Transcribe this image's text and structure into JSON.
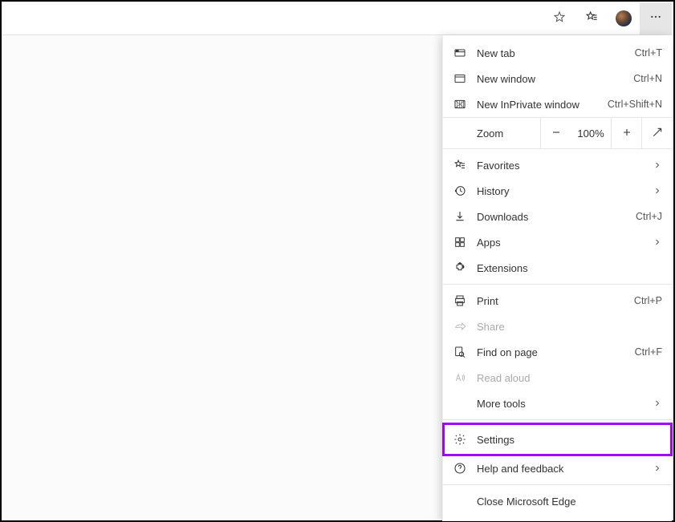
{
  "topbar": {
    "star_outline": "favorite",
    "favorites_star": "favorites",
    "more": "more"
  },
  "menu": {
    "newTab": {
      "label": "New tab",
      "shortcut": "Ctrl+T"
    },
    "newWindow": {
      "label": "New window",
      "shortcut": "Ctrl+N"
    },
    "newInPrivate": {
      "label": "New InPrivate window",
      "shortcut": "Ctrl+Shift+N"
    },
    "zoom": {
      "label": "Zoom",
      "value": "100%"
    },
    "favorites": {
      "label": "Favorites"
    },
    "history": {
      "label": "History"
    },
    "downloads": {
      "label": "Downloads",
      "shortcut": "Ctrl+J"
    },
    "apps": {
      "label": "Apps"
    },
    "extensions": {
      "label": "Extensions"
    },
    "print": {
      "label": "Print",
      "shortcut": "Ctrl+P"
    },
    "share": {
      "label": "Share"
    },
    "findOnPage": {
      "label": "Find on page",
      "shortcut": "Ctrl+F"
    },
    "readAloud": {
      "label": "Read aloud"
    },
    "moreTools": {
      "label": "More tools"
    },
    "settings": {
      "label": "Settings"
    },
    "help": {
      "label": "Help and feedback"
    },
    "close": {
      "label": "Close Microsoft Edge"
    }
  }
}
